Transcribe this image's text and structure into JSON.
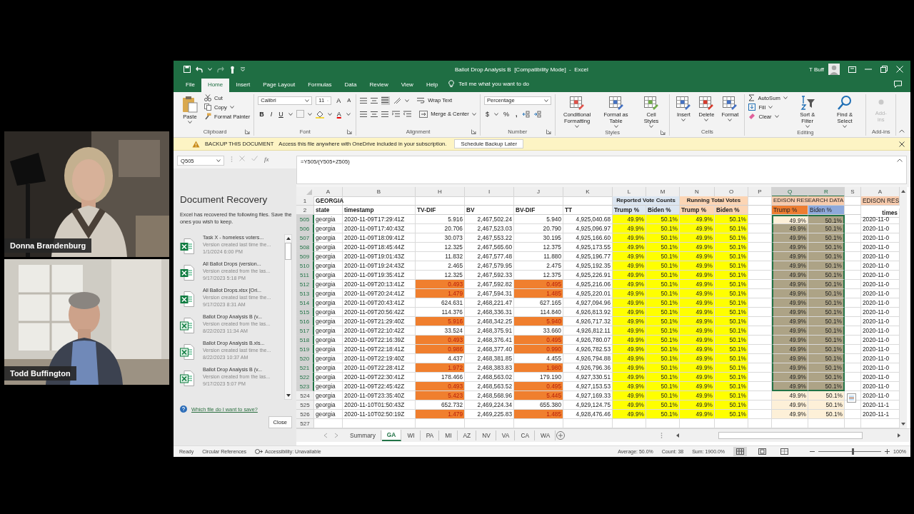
{
  "participants": [
    {
      "name": "Donna Brandenburg",
      "kind": "picture"
    },
    {
      "name": "Todd Buffington",
      "kind": "picture"
    }
  ],
  "excel": {
    "title": "Ballot Drop Analysis B  [Compatibility Mode]  -  Excel",
    "user": "T Buff",
    "tabs": [
      {
        "label": "File",
        "selected": false
      },
      {
        "label": "Home",
        "selected": true
      },
      {
        "label": "Insert",
        "selected": false
      },
      {
        "label": "Page Layout",
        "selected": false
      },
      {
        "label": "Formulas",
        "selected": false
      },
      {
        "label": "Data",
        "selected": false
      },
      {
        "label": "Review",
        "selected": false
      },
      {
        "label": "View",
        "selected": false
      },
      {
        "label": "Help",
        "selected": false
      }
    ],
    "tell_me": "Tell me what you want to do",
    "ribbon": [
      {
        "kind": "clipboard",
        "label": "Clipboard",
        "launcher": true,
        "paste": "Paste",
        "small": [
          "Cut",
          "Copy",
          "Format Painter"
        ]
      },
      {
        "kind": "font",
        "label": "Font",
        "launcher": true,
        "font": "Calibri",
        "size": "11",
        "grow": "A",
        "shrink": "A",
        "bold": "B",
        "italic": "I",
        "underline": "U",
        "font_color_letter": "A"
      },
      {
        "kind": "alignment",
        "label": "Alignment",
        "launcher": true,
        "wrap": "Wrap Text",
        "merge": "Merge & Center"
      },
      {
        "kind": "number",
        "label": "Number",
        "launcher": true,
        "format": "Percentage",
        "currency": "$",
        "percent": "%",
        "comma": ","
      },
      {
        "kind": "large_row",
        "label": "Styles",
        "launcher": true,
        "disabled": false,
        "buttons": [
          "Conditional Formatting",
          "Format as Table",
          "Cell Styles"
        ]
      },
      {
        "kind": "large_row",
        "label": "Cells",
        "launcher": false,
        "disabled": false,
        "buttons": [
          "Insert",
          "Delete",
          "Format"
        ]
      },
      {
        "kind": "editing",
        "label": "Editing",
        "launcher": false,
        "small": [
          "AutoSum",
          "Fill",
          "Clear"
        ],
        "large": [
          "Sort & Filter",
          "Find & Select"
        ]
      },
      {
        "kind": "large_row",
        "label": "Add-ins",
        "launcher": false,
        "disabled": true,
        "buttons": [
          "Add-ins"
        ]
      }
    ],
    "message_bar": {
      "title": "BACKUP THIS DOCUMENT",
      "text": "Access this file anywhere with OneDrive included in your subscription.",
      "button": "Schedule Backup Later"
    },
    "name_box": "Q505",
    "function_label": "fx",
    "formula": "=Y505/(Y505+Z505)",
    "recovery": {
      "title": "Document Recovery",
      "intro": "Excel has recovered the following files. Save the ones you wish to keep.",
      "files": [
        {
          "kind": "xlsx",
          "name": "Task X - homeless voters...",
          "description": "Version created last time the...",
          "time": "1/1/2024 6:00 PM"
        },
        {
          "kind": "xlsx",
          "name": "All Ballot Drops (version...",
          "description": "Version created from the las...",
          "time": "9/17/2023 5:18 PM"
        },
        {
          "kind": "xlsx",
          "name": "All Ballot Drops.xlsx  [Ori...",
          "description": "Version created last time the...",
          "time": "9/17/2023 8:31 AM"
        },
        {
          "kind": "xls",
          "name": "Ballot Drop Analysis B (v...",
          "description": "Version created from the las...",
          "time": "8/22/2023 11:34 AM"
        },
        {
          "kind": "xls",
          "name": "Ballot Drop Analysis B.xls...",
          "description": "Version created last time the...",
          "time": "8/22/2023 10:37 AM"
        },
        {
          "kind": "xls",
          "name": "Ballot Drop Analysis B (v...",
          "description": "Version created from the las...",
          "time": "9/17/2023 5:07 PM"
        }
      ],
      "help_link": "Which file do I want to save?",
      "close": "Close"
    },
    "sheet": {
      "columns": [
        {
          "letter": "A",
          "selected": false
        },
        {
          "letter": "B",
          "selected": false
        },
        {
          "letter": "H",
          "selected": false
        },
        {
          "letter": "I",
          "selected": false
        },
        {
          "letter": "J",
          "selected": false
        },
        {
          "letter": "K",
          "selected": false
        },
        {
          "letter": "L",
          "selected": false
        },
        {
          "letter": "M",
          "selected": false
        },
        {
          "letter": "N",
          "selected": false
        },
        {
          "letter": "O",
          "selected": false
        },
        {
          "letter": "P",
          "selected": false
        },
        {
          "letter": "Q",
          "selected": true
        },
        {
          "letter": "R",
          "selected": true
        },
        {
          "letter": "S",
          "selected": false
        },
        {
          "letter": "A",
          "selected": false
        }
      ],
      "header_rows": [
        {
          "number": "1",
          "cells": [
            {
              "text": "GEORGIA",
              "bold": true,
              "merged": false
            },
            {
              "merged": false
            },
            {
              "merged": false
            },
            {
              "merged": false
            },
            {
              "merged": false
            },
            {
              "merged": false
            },
            {
              "text": "Reported Vote Counts",
              "color": "#dce6f1",
              "bold": true,
              "merged": true
            },
            {
              "text": "Running Total Votes",
              "color": "#fcd5b4",
              "bold": true,
              "merged": true
            },
            {
              "merged": false
            },
            {
              "text": "EDISON RESEARCH DATA",
              "color": "#f8cbad",
              "bold": false,
              "merged": true
            },
            {
              "merged": false
            },
            {
              "text": "EDISON RES",
              "color": "#f8cbad",
              "bold": false,
              "merged": false
            }
          ]
        },
        {
          "number": "2",
          "cells": [
            {
              "text": "state",
              "bold": true,
              "merged": false
            },
            {
              "text": "timestamp",
              "bold": true,
              "merged": false
            },
            {
              "text": "TV-DIF",
              "bold": true,
              "merged": false
            },
            {
              "text": "BV",
              "bold": true,
              "merged": false
            },
            {
              "text": "BV-DIF",
              "bold": true,
              "merged": false
            },
            {
              "text": "TT",
              "bold": true,
              "merged": false
            },
            {
              "text": "Trump %",
              "color": "#dce6f1",
              "bold": true,
              "merged": false
            },
            {
              "text": "Biden %",
              "color": "#dce6f1",
              "bold": true,
              "merged": false
            },
            {
              "text": "Trump %",
              "color": "#fcd5b4",
              "bold": true,
              "merged": false
            },
            {
              "text": "Biden %",
              "color": "#fcd5b4",
              "bold": true,
              "merged": false
            },
            {
              "merged": false
            },
            {
              "text": "Trump %",
              "color": "#ed7d31",
              "bold": false,
              "merged": false
            },
            {
              "text": "Biden %",
              "color": "#8ea9db",
              "bold": false,
              "merged": false
            },
            {
              "merged": false
            },
            {
              "text": "times",
              "bold": true,
              "merged": false
            }
          ]
        }
      ],
      "rows": [
        {
          "n": "505",
          "state": "georgia",
          "timestamp": "2020-11-09T17:29:41Z",
          "tv_dif": "5.916",
          "bv": "2,467,502.24",
          "bv_dif": "5.940",
          "tt": "4,925,040.68",
          "rep_trump": "49.9%",
          "rep_biden": "50.1%",
          "run_trump": "49.9%",
          "run_biden": "50.1%",
          "edison_trump": "49.9%",
          "edison_biden": "50.1%",
          "column_a": "2020-11-0",
          "flagged": false,
          "selected": true,
          "active": true
        },
        {
          "n": "506",
          "state": "georgia",
          "timestamp": "2020-11-09T17:40:43Z",
          "tv_dif": "20.706",
          "bv": "2,467,523.03",
          "bv_dif": "20.790",
          "tt": "4,925,096.97",
          "rep_trump": "49.9%",
          "rep_biden": "50.1%",
          "run_trump": "49.9%",
          "run_biden": "50.1%",
          "edison_trump": "49.9%",
          "edison_biden": "50.1%",
          "column_a": "2020-11-0",
          "flagged": false,
          "selected": true,
          "active": false
        },
        {
          "n": "507",
          "state": "georgia",
          "timestamp": "2020-11-09T18:09:41Z",
          "tv_dif": "30.073",
          "bv": "2,467,553.22",
          "bv_dif": "30.195",
          "tt": "4,925,166.60",
          "rep_trump": "49.9%",
          "rep_biden": "50.1%",
          "run_trump": "49.9%",
          "run_biden": "50.1%",
          "edison_trump": "49.9%",
          "edison_biden": "50.1%",
          "column_a": "2020-11-0",
          "flagged": false,
          "selected": true,
          "active": false
        },
        {
          "n": "508",
          "state": "georgia",
          "timestamp": "2020-11-09T18:45:44Z",
          "tv_dif": "12.325",
          "bv": "2,467,565.60",
          "bv_dif": "12.375",
          "tt": "4,925,173.55",
          "rep_trump": "49.9%",
          "rep_biden": "50.1%",
          "run_trump": "49.9%",
          "run_biden": "50.1%",
          "edison_trump": "49.9%",
          "edison_biden": "50.1%",
          "column_a": "2020-11-0",
          "flagged": false,
          "selected": true,
          "active": false
        },
        {
          "n": "509",
          "state": "georgia",
          "timestamp": "2020-11-09T19:01:43Z",
          "tv_dif": "11.832",
          "bv": "2,467,577.48",
          "bv_dif": "11.880",
          "tt": "4,925,196.77",
          "rep_trump": "49.9%",
          "rep_biden": "50.1%",
          "run_trump": "49.9%",
          "run_biden": "50.1%",
          "edison_trump": "49.9%",
          "edison_biden": "50.1%",
          "column_a": "2020-11-0",
          "flagged": false,
          "selected": true,
          "active": false
        },
        {
          "n": "510",
          "state": "georgia",
          "timestamp": "2020-11-09T19:24:43Z",
          "tv_dif": "2.465",
          "bv": "2,467,579.95",
          "bv_dif": "2.475",
          "tt": "4,925,192.35",
          "rep_trump": "49.9%",
          "rep_biden": "50.1%",
          "run_trump": "49.9%",
          "run_biden": "50.1%",
          "edison_trump": "49.9%",
          "edison_biden": "50.1%",
          "column_a": "2020-11-0",
          "flagged": false,
          "selected": true,
          "active": false
        },
        {
          "n": "511",
          "state": "georgia",
          "timestamp": "2020-11-09T19:35:41Z",
          "tv_dif": "12.325",
          "bv": "2,467,592.33",
          "bv_dif": "12.375",
          "tt": "4,925,226.91",
          "rep_trump": "49.9%",
          "rep_biden": "50.1%",
          "run_trump": "49.9%",
          "run_biden": "50.1%",
          "edison_trump": "49.9%",
          "edison_biden": "50.1%",
          "column_a": "2020-11-0",
          "flagged": false,
          "selected": true,
          "active": false
        },
        {
          "n": "512",
          "state": "georgia",
          "timestamp": "2020-11-09T20:13:41Z",
          "tv_dif": "0.493",
          "bv": "2,467,592.82",
          "bv_dif": "0.495",
          "tt": "4,925,216.06",
          "rep_trump": "49.9%",
          "rep_biden": "50.1%",
          "run_trump": "49.9%",
          "run_biden": "50.1%",
          "edison_trump": "49.9%",
          "edison_biden": "50.1%",
          "column_a": "2020-11-0",
          "flagged": true,
          "selected": true,
          "active": false
        },
        {
          "n": "513",
          "state": "georgia",
          "timestamp": "2020-11-09T20:24:41Z",
          "tv_dif": "1.479",
          "bv": "2,467,594.31",
          "bv_dif": "1.485",
          "tt": "4,925,220.01",
          "rep_trump": "49.9%",
          "rep_biden": "50.1%",
          "run_trump": "49.9%",
          "run_biden": "50.1%",
          "edison_trump": "49.9%",
          "edison_biden": "50.1%",
          "column_a": "2020-11-0",
          "flagged": true,
          "selected": true,
          "active": false
        },
        {
          "n": "514",
          "state": "georgia",
          "timestamp": "2020-11-09T20:43:41Z",
          "tv_dif": "624.631",
          "bv": "2,468,221.47",
          "bv_dif": "627.165",
          "tt": "4,927,094.96",
          "rep_trump": "49.9%",
          "rep_biden": "50.1%",
          "run_trump": "49.9%",
          "run_biden": "50.1%",
          "edison_trump": "49.9%",
          "edison_biden": "50.1%",
          "column_a": "2020-11-0",
          "flagged": false,
          "selected": true,
          "active": false
        },
        {
          "n": "515",
          "state": "georgia",
          "timestamp": "2020-11-09T20:56:42Z",
          "tv_dif": "114.376",
          "bv": "2,468,336.31",
          "bv_dif": "114.840",
          "tt": "4,926,813.92",
          "rep_trump": "49.9%",
          "rep_biden": "50.1%",
          "run_trump": "49.9%",
          "run_biden": "50.1%",
          "edison_trump": "49.9%",
          "edison_biden": "50.1%",
          "column_a": "2020-11-0",
          "flagged": false,
          "selected": true,
          "active": false
        },
        {
          "n": "516",
          "state": "georgia",
          "timestamp": "2020-11-09T21:29:40Z",
          "tv_dif": "5.916",
          "bv": "2,468,342.25",
          "bv_dif": "5.940",
          "tt": "4,926,717.32",
          "rep_trump": "49.9%",
          "rep_biden": "50.1%",
          "run_trump": "49.9%",
          "run_biden": "50.1%",
          "edison_trump": "49.9%",
          "edison_biden": "50.1%",
          "column_a": "2020-11-0",
          "flagged": true,
          "selected": true,
          "active": false
        },
        {
          "n": "517",
          "state": "georgia",
          "timestamp": "2020-11-09T22:10:42Z",
          "tv_dif": "33.524",
          "bv": "2,468,375.91",
          "bv_dif": "33.660",
          "tt": "4,926,812.11",
          "rep_trump": "49.9%",
          "rep_biden": "50.1%",
          "run_trump": "49.9%",
          "run_biden": "50.1%",
          "edison_trump": "49.9%",
          "edison_biden": "50.1%",
          "column_a": "2020-11-0",
          "flagged": false,
          "selected": true,
          "active": false
        },
        {
          "n": "518",
          "state": "georgia",
          "timestamp": "2020-11-09T22:16:39Z",
          "tv_dif": "0.493",
          "bv": "2,468,376.41",
          "bv_dif": "0.495",
          "tt": "4,926,780.07",
          "rep_trump": "49.9%",
          "rep_biden": "50.1%",
          "run_trump": "49.9%",
          "run_biden": "50.1%",
          "edison_trump": "49.9%",
          "edison_biden": "50.1%",
          "column_a": "2020-11-0",
          "flagged": true,
          "selected": true,
          "active": false
        },
        {
          "n": "519",
          "state": "georgia",
          "timestamp": "2020-11-09T22:18:41Z",
          "tv_dif": "0.986",
          "bv": "2,468,377.40",
          "bv_dif": "0.990",
          "tt": "4,926,782.53",
          "rep_trump": "49.9%",
          "rep_biden": "50.1%",
          "run_trump": "49.9%",
          "run_biden": "50.1%",
          "edison_trump": "49.9%",
          "edison_biden": "50.1%",
          "column_a": "2020-11-0",
          "flagged": true,
          "selected": true,
          "active": false
        },
        {
          "n": "520",
          "state": "georgia",
          "timestamp": "2020-11-09T22:19:40Z",
          "tv_dif": "4.437",
          "bv": "2,468,381.85",
          "bv_dif": "4.455",
          "tt": "4,926,794.88",
          "rep_trump": "49.9%",
          "rep_biden": "50.1%",
          "run_trump": "49.9%",
          "run_biden": "50.1%",
          "edison_trump": "49.9%",
          "edison_biden": "50.1%",
          "column_a": "2020-11-0",
          "flagged": false,
          "selected": true,
          "active": false
        },
        {
          "n": "521",
          "state": "georgia",
          "timestamp": "2020-11-09T22:28:41Z",
          "tv_dif": "1.972",
          "bv": "2,468,383.83",
          "bv_dif": "1.980",
          "tt": "4,926,796.36",
          "rep_trump": "49.9%",
          "rep_biden": "50.1%",
          "run_trump": "49.9%",
          "run_biden": "50.1%",
          "edison_trump": "49.9%",
          "edison_biden": "50.1%",
          "column_a": "2020-11-0",
          "flagged": true,
          "selected": true,
          "active": false
        },
        {
          "n": "522",
          "state": "georgia",
          "timestamp": "2020-11-09T22:30:41Z",
          "tv_dif": "178.466",
          "bv": "2,468,563.02",
          "bv_dif": "179.190",
          "tt": "4,927,330.51",
          "rep_trump": "49.9%",
          "rep_biden": "50.1%",
          "run_trump": "49.9%",
          "run_biden": "50.1%",
          "edison_trump": "49.9%",
          "edison_biden": "50.1%",
          "column_a": "2020-11-0",
          "flagged": false,
          "selected": true,
          "active": false
        },
        {
          "n": "523",
          "state": "georgia",
          "timestamp": "2020-11-09T22:45:42Z",
          "tv_dif": "0.493",
          "bv": "2,468,563.52",
          "bv_dif": "0.495",
          "tt": "4,927,153.53",
          "rep_trump": "49.9%",
          "rep_biden": "50.1%",
          "run_trump": "49.9%",
          "run_biden": "50.1%",
          "edison_trump": "49.9%",
          "edison_biden": "50.1%",
          "column_a": "2020-11-0",
          "flagged": true,
          "selected": true,
          "active": false
        },
        {
          "n": "524",
          "state": "georgia",
          "timestamp": "2020-11-09T23:35:40Z",
          "tv_dif": "5.423",
          "bv": "2,468,568.96",
          "bv_dif": "5.445",
          "tt": "4,927,169.33",
          "rep_trump": "49.9%",
          "rep_biden": "50.1%",
          "run_trump": "49.9%",
          "run_biden": "50.1%",
          "edison_trump": "49.9%",
          "edison_biden": "50.1%",
          "column_a": "2020-11-0",
          "flagged": true,
          "selected": false,
          "active": false
        },
        {
          "n": "525",
          "state": "georgia",
          "timestamp": "2020-11-10T01:50:43Z",
          "tv_dif": "652.732",
          "bv": "2,469,224.34",
          "bv_dif": "655.380",
          "tt": "4,929,124.75",
          "rep_trump": "49.9%",
          "rep_biden": "50.1%",
          "run_trump": "49.9%",
          "run_biden": "50.1%",
          "edison_trump": "49.9%",
          "edison_biden": "50.1%",
          "column_a": "2020-11-1",
          "flagged": false,
          "selected": false,
          "active": false
        },
        {
          "n": "526",
          "state": "georgia",
          "timestamp": "2020-11-10T02:50:19Z",
          "tv_dif": "1.479",
          "bv": "2,469,225.83",
          "bv_dif": "1.485",
          "tt": "4,928,476.46",
          "rep_trump": "49.9%",
          "rep_biden": "50.1%",
          "run_trump": "49.9%",
          "run_biden": "50.1%",
          "edison_trump": "49.9%",
          "edison_biden": "50.1%",
          "column_a": "2020-11-1",
          "flagged": true,
          "selected": false,
          "active": false
        }
      ],
      "empty_row": "527"
    },
    "sheet_tabs": [
      {
        "label": "Summary",
        "selected": false
      },
      {
        "label": "GA",
        "selected": true
      },
      {
        "label": "WI",
        "selected": false
      },
      {
        "label": "PA",
        "selected": false
      },
      {
        "label": "MI",
        "selected": false
      },
      {
        "label": "AZ",
        "selected": false
      },
      {
        "label": "NV",
        "selected": false
      },
      {
        "label": "VA",
        "selected": false
      },
      {
        "label": "CA",
        "selected": false
      },
      {
        "label": "WA",
        "selected": false
      }
    ],
    "status": {
      "mode": "Ready",
      "circular": "Circular References",
      "accessibility": "Accessibility: Unavailable",
      "average": "Average: 50.0%",
      "count": "Count: 38",
      "sum": "Sum: 1900.0%",
      "views": [
        {
          "kind": "normal",
          "selected": true
        },
        {
          "kind": "page_layout",
          "selected": false
        },
        {
          "kind": "page_break",
          "selected": false
        }
      ],
      "zoom": {
        "level": 0.55,
        "reading": "100%"
      }
    }
  }
}
